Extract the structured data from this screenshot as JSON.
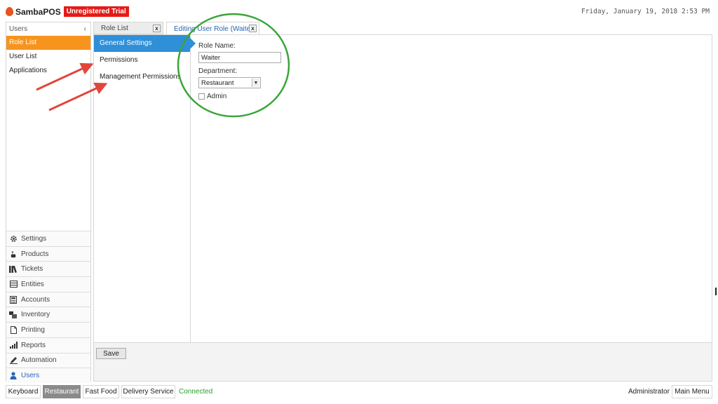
{
  "app": {
    "brand": "SambaPOS",
    "trial_badge": "Unregistered Trial",
    "datetime": "Friday, January 19, 2018 2:53 PM"
  },
  "sidebar": {
    "header": "Users",
    "collapse_glyph": "‹",
    "items": [
      {
        "label": "Role List",
        "active": true
      },
      {
        "label": "User List"
      },
      {
        "label": "Applications"
      }
    ],
    "nav": [
      {
        "label": "Settings",
        "icon": "gear-icon"
      },
      {
        "label": "Products",
        "icon": "coffee-icon"
      },
      {
        "label": "Tickets",
        "icon": "books-icon"
      },
      {
        "label": "Entities",
        "icon": "table-icon"
      },
      {
        "label": "Accounts",
        "icon": "calculator-icon"
      },
      {
        "label": "Inventory",
        "icon": "boxes-icon"
      },
      {
        "label": "Printing",
        "icon": "document-icon"
      },
      {
        "label": "Reports",
        "icon": "bar-chart-icon"
      },
      {
        "label": "Automation",
        "icon": "pen-icon"
      },
      {
        "label": "Users",
        "icon": "user-icon",
        "active": true
      }
    ]
  },
  "tabs": [
    {
      "label": "Role List",
      "close": "x"
    },
    {
      "label": "Editing User Role (Waiter)",
      "close": "x",
      "active": true
    }
  ],
  "sections": [
    {
      "label": "General Settings",
      "active": true
    },
    {
      "label": "Permissions"
    },
    {
      "label": "Management Permissions"
    }
  ],
  "form": {
    "role_name_label": "Role Name:",
    "role_name_value": "Waiter",
    "department_label": "Department:",
    "department_value": "Restaurant",
    "admin_label": "Admin",
    "admin_checked": false
  },
  "footer": {
    "save_label": "Save"
  },
  "statusbar": {
    "keyboard": "Keyboard",
    "departments": [
      {
        "label": "Restaurant",
        "active": true
      },
      {
        "label": "Fast Food"
      },
      {
        "label": "Delivery Service"
      }
    ],
    "connection": "Connected",
    "user": "Administrator",
    "main_menu": "Main Menu"
  },
  "colors": {
    "brand_red": "#e41b17",
    "orange_active": "#f7941d",
    "blue_active": "#2f8fd8",
    "annotation_green": "#3aa53a",
    "annotation_red": "#e0463b",
    "connected_green": "#2ea12e"
  }
}
